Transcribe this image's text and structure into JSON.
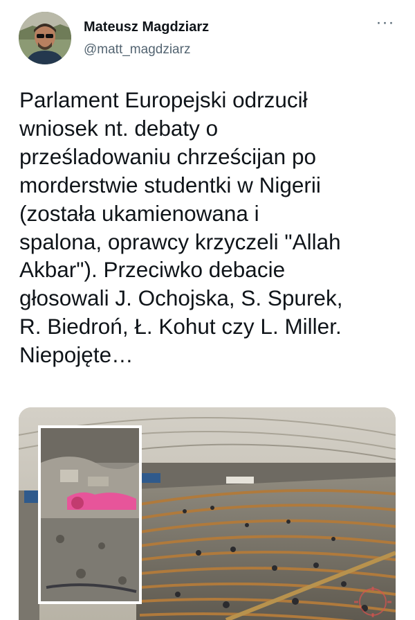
{
  "author": {
    "display_name": "Mateusz Magdziarz",
    "handle": "@matt_magdziarz"
  },
  "more_button": "···",
  "tweet": {
    "text": "Parlament Europejski odrzucił\nwniosek nt. debaty o\nprześladowaniu chrześcijan po\nmorderstwie studentki w Nigerii\n(została ukamienowana i\nspalona, oprawcy krzyczeli \"Allah\nAkbar\"). Przeciwko debacie\ngłosowali J. Ochojska, S. Spurek,\nR. Biedroń, Ł. Kohut czy L. Miller.\nNiepojęte…"
  },
  "media": {
    "main_image": "european-parliament-plenary-hall",
    "inset_image": "rubble-and-debris-photo"
  },
  "watermark_logo": "jbzd-logo",
  "colors": {
    "text_primary": "#0f1419",
    "text_secondary": "#536471",
    "seat_color": "#b07a3c",
    "watermark": "#d9534f"
  }
}
